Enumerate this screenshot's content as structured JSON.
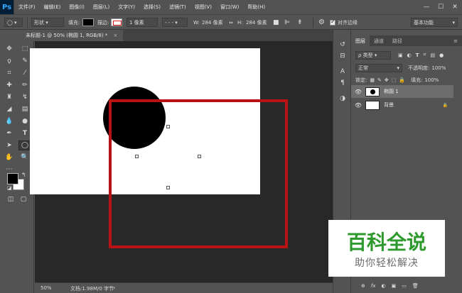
{
  "app": {
    "logo": "Ps",
    "menu": [
      "文件(F)",
      "编辑(E)",
      "图像(I)",
      "图层(L)",
      "文字(Y)",
      "选择(S)",
      "滤镜(T)",
      "视图(V)",
      "窗口(W)",
      "帮助(H)"
    ],
    "window_controls": [
      "—",
      "☐",
      "✕"
    ]
  },
  "options_bar": {
    "shape_mode": "形状",
    "fill_label": "填充:",
    "stroke_label": "描边:",
    "stroke_width": "1 像素",
    "width_label": "W:",
    "width_value": "284 像素",
    "link_icon": "⇔",
    "height_label": "H:",
    "height_value": "284 像素",
    "align_edges_label": "对齐边缘",
    "workspace": "基本功能"
  },
  "document": {
    "tab_title": "未标题-1 @ 50% (椭圆 1, RGB/8) *",
    "tab_close": "×",
    "zoom": "50%",
    "doc_info": "文档:1.98M/0 字节"
  },
  "layers_panel": {
    "tabs": [
      "图层",
      "通道",
      "路径"
    ],
    "filter_label": "ρ 类型",
    "blend_mode": "正常",
    "opacity_label": "不透明度:",
    "opacity_value": "100%",
    "lock_label": "锁定:",
    "fill_label": "填充:",
    "fill_value": "100%",
    "layers": [
      {
        "name": "椭圆 1",
        "selected": true
      },
      {
        "name": "背景",
        "selected": false,
        "lock_icon": "🔒"
      }
    ],
    "bottom_icons": [
      "⊕",
      "fx",
      "◐",
      "▣",
      "▭",
      "🗑"
    ]
  },
  "watermark": {
    "title": "百科全说",
    "subtitle": "助你轻松解决"
  },
  "colors": {
    "foreground": "#000000",
    "background": "#ffffff",
    "highlight_box": "#b81212",
    "watermark_green": "#2e9a2e"
  }
}
